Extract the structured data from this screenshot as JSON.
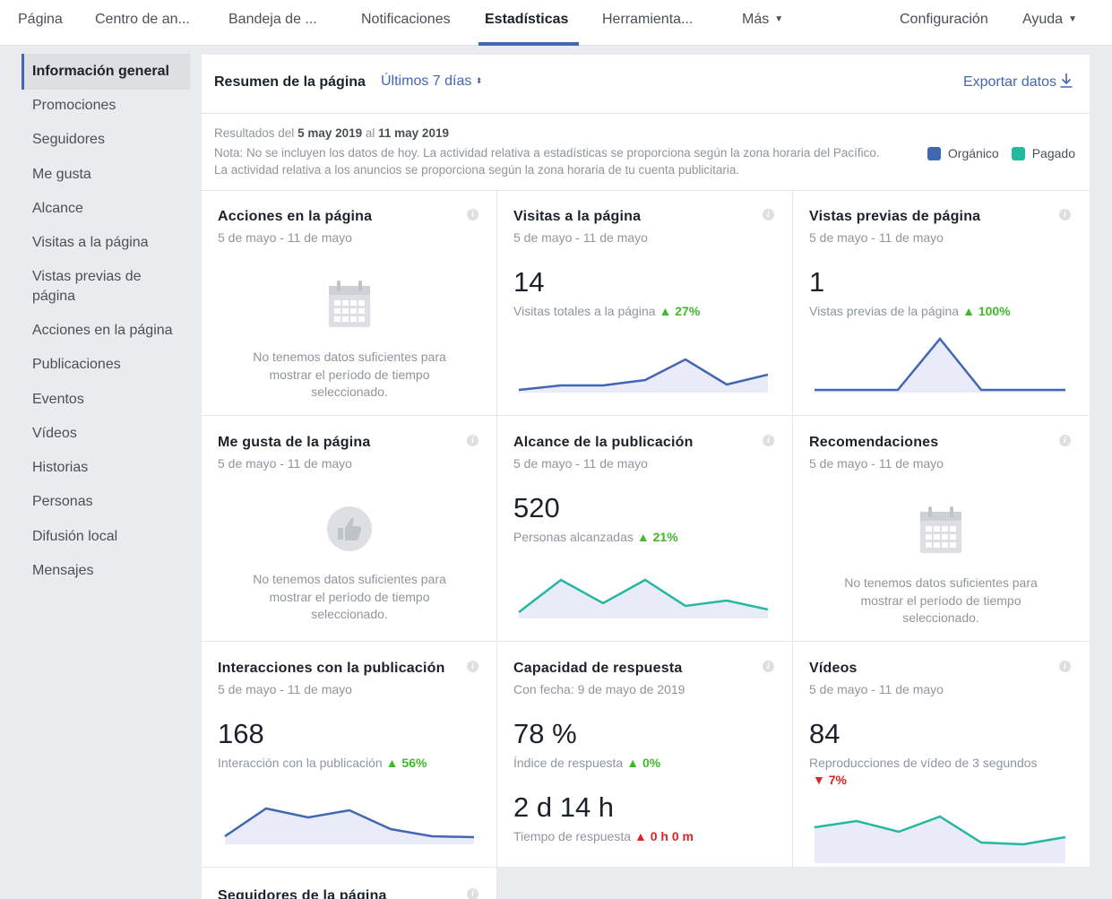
{
  "nav": {
    "pagina": "Página",
    "centro": "Centro de an...",
    "bandeja": "Bandeja de ...",
    "notificaciones": "Notificaciones",
    "estadisticas": "Estadísticas",
    "herramientas": "Herramienta...",
    "mas": "Más",
    "configuracion": "Configuración",
    "ayuda": "Ayuda"
  },
  "sidebar": {
    "items": [
      "Información general",
      "Promociones",
      "Seguidores",
      "Me gusta",
      "Alcance",
      "Visitas a la página",
      "Vistas previas de página",
      "Acciones en la página",
      "Publicaciones",
      "Eventos",
      "Vídeos",
      "Historias",
      "Personas",
      "Difusión local",
      "Mensajes"
    ]
  },
  "header": {
    "title": "Resumen de la página",
    "range": "Últimos 7 días",
    "export": "Exportar datos"
  },
  "notes": {
    "results_prefix": "Resultados del ",
    "from": "5 may 2019",
    "mid": " al ",
    "to": "11 may 2019",
    "note": "Nota: No se incluyen los datos de hoy. La actividad relativa a estadísticas se proporciona según la zona horaria del Pacífico. La actividad relativa a los anuncios se proporciona según la zona horaria de tu cuenta publicitaria.",
    "legend_organic": "Orgánico",
    "legend_paid": "Pagado"
  },
  "colors": {
    "organic": "#4267b2",
    "paid": "#24b8a0",
    "up": "#42b72a",
    "down": "#e02424"
  },
  "empty_text": "No tenemos datos suficientes para mostrar el período de tiempo seleccionado.",
  "cards": {
    "acciones": {
      "title": "Acciones en la página",
      "date": "5 de mayo - 11 de mayo",
      "icon": "calendar-icon"
    },
    "visitas": {
      "title": "Visitas a la página",
      "date": "5 de mayo - 11 de mayo",
      "value": "14",
      "label": "Visitas totales a la página",
      "change": "▲ 27%"
    },
    "vistas": {
      "title": "Vistas previas de página",
      "date": "5 de mayo - 11 de mayo",
      "value": "1",
      "label": "Vistas previas de la página",
      "change": "▲ 100%"
    },
    "megusta": {
      "title": "Me gusta de la página",
      "date": "5 de mayo - 11 de mayo",
      "icon": "thumbs-up-icon"
    },
    "alcance": {
      "title": "Alcance de la publicación",
      "date": "5 de mayo - 11 de mayo",
      "value": "520",
      "label": "Personas alcanzadas",
      "change": "▲ 21%"
    },
    "recomendaciones": {
      "title": "Recomendaciones",
      "date": "5 de mayo - 11 de mayo",
      "icon": "calendar-icon"
    },
    "interacciones": {
      "title": "Interacciones con la publicación",
      "date": "5 de mayo - 11 de mayo",
      "value": "168",
      "label": "Interacción con la publicación",
      "change": "▲ 56%"
    },
    "capacidad": {
      "title": "Capacidad de respuesta",
      "date": "Con fecha: 9 de mayo de 2019",
      "value": "78 %",
      "label": "Índice de respuesta",
      "change": "▲ 0%",
      "value2": "2 d 14 h",
      "label2": "Tiempo de respuesta",
      "change2": "▲ 0 h 0 m"
    },
    "videos": {
      "title": "Vídeos",
      "date": "5 de mayo - 11 de mayo",
      "value": "84",
      "label": "Reproducciones de vídeo de 3 segundos",
      "change": "▼ 7%"
    },
    "seguidores": {
      "title": "Seguidores de la página"
    }
  }
}
